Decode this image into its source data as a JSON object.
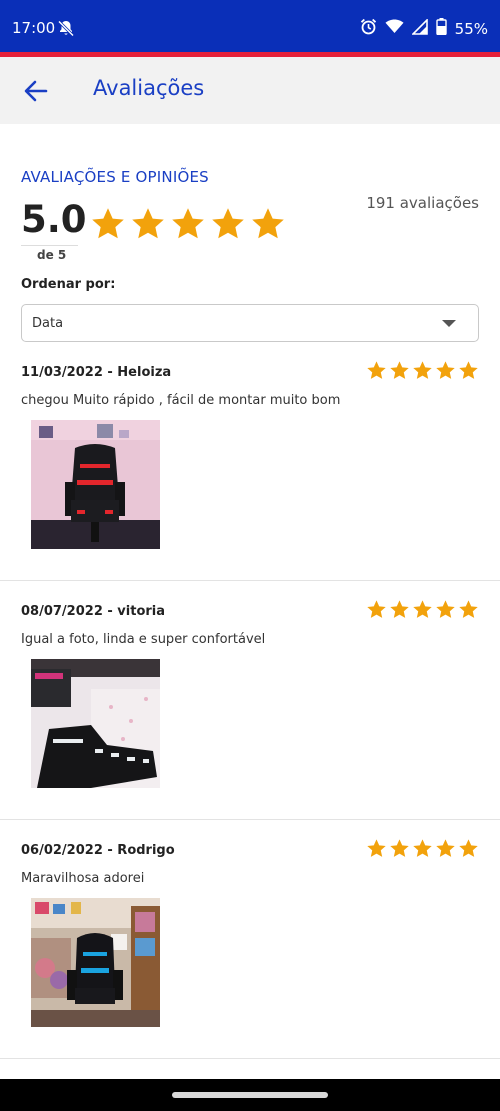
{
  "status_bar": {
    "time": "17:00",
    "battery": "55%",
    "icons": [
      "bell-off-icon",
      "alarm-icon",
      "wifi-icon",
      "signal-icon",
      "battery-icon"
    ]
  },
  "app_bar": {
    "title": "Avaliações",
    "back_icon": "arrow-left-icon"
  },
  "summary": {
    "section_title": "AVALIAÇÕES E OPINIÕES",
    "rating": "5.0",
    "rating_scale": "de 5",
    "count": "191 avaliações",
    "stars": 5
  },
  "sort": {
    "label": "Ordenar por:",
    "selected": "Data"
  },
  "reviews": [
    {
      "date": "11/03/2022",
      "author": "Heloiza",
      "header": "11/03/2022 - Heloiza",
      "stars": 5,
      "text": "chegou Muito rápido , fácil de montar muito bom",
      "photo_accent": "#e3262c"
    },
    {
      "date": "08/07/2022",
      "author": "vitoria",
      "header": "08/07/2022 - vitoria",
      "stars": 5,
      "text": "Igual a foto, linda e super confortável",
      "photo_accent": "#e9edf0"
    },
    {
      "date": "06/02/2022",
      "author": "Rodrigo",
      "header": "06/02/2022 - Rodrigo",
      "stars": 5,
      "text": "Maravilhosa adorei",
      "photo_accent": "#1aa3e0"
    }
  ],
  "colors": {
    "brand_blue": "#1a3fc4",
    "status_bar": "#0a2fb8",
    "accent_red": "#e5203a",
    "star": "#f2a20c"
  }
}
